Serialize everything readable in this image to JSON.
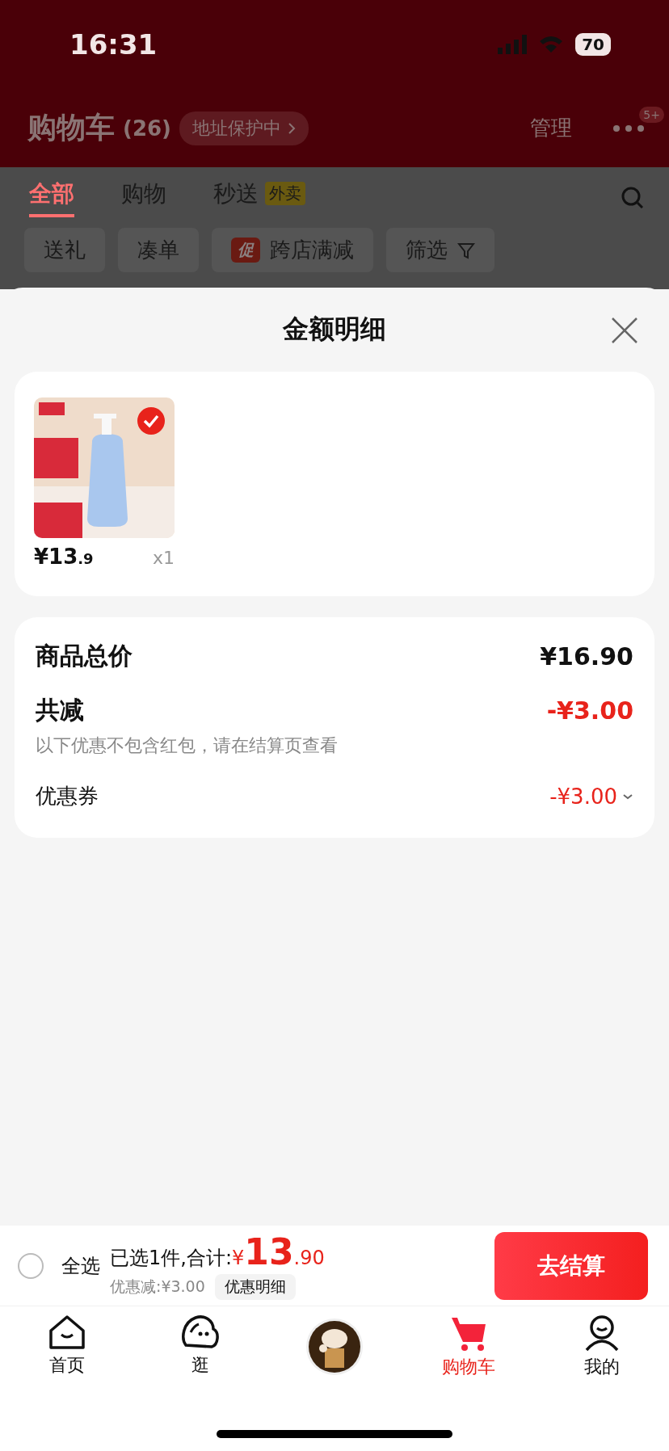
{
  "status_bar": {
    "time": "16:31",
    "battery": "70"
  },
  "header": {
    "title": "购物车",
    "count": "(26)",
    "address_pill": "地址保护中",
    "manage": "管理",
    "badge": "5+"
  },
  "tabs": [
    {
      "label": "全部",
      "selected": true
    },
    {
      "label": "购物",
      "selected": false
    },
    {
      "label": "秒送",
      "selected": false,
      "tag": "外卖"
    }
  ],
  "filters": [
    {
      "label": "送礼"
    },
    {
      "label": "凑单"
    },
    {
      "label": "跨店满减",
      "tag": "促"
    },
    {
      "label": "筛选",
      "kind": "filter"
    }
  ],
  "sheet": {
    "title": "金额明细",
    "products": [
      {
        "kind": "picture",
        "selected": true,
        "price_main": "¥13",
        "price_decimal": ".9",
        "quantity": "x1"
      }
    ],
    "summary": [
      {
        "kind": "total",
        "label": "商品总价",
        "value": "¥16.90"
      },
      {
        "kind": "discount",
        "label": "共减",
        "value": "-¥3.00",
        "note": "以下优惠不包含红包，请在结算页查看"
      },
      {
        "kind": "coupon",
        "label": "优惠券",
        "value": "-¥3.00"
      }
    ]
  },
  "checkout_bar": {
    "select_all": {
      "label": "全选",
      "checked": false
    },
    "selected_text": "已选1件,合计:",
    "currency": "¥",
    "total_main": "13",
    "total_decimal": ".90",
    "discount_text": "优惠减:¥3.00",
    "details_button": "优惠明细",
    "checkout_button": "去结算"
  },
  "nav": [
    {
      "kind": "tab",
      "label": "首页",
      "selected": false
    },
    {
      "kind": "tab",
      "label": "逛",
      "selected": false
    },
    {
      "kind": "picture"
    },
    {
      "kind": "tab",
      "label": "购物车",
      "selected": true
    },
    {
      "kind": "tab",
      "label": "我的",
      "selected": false
    }
  ]
}
